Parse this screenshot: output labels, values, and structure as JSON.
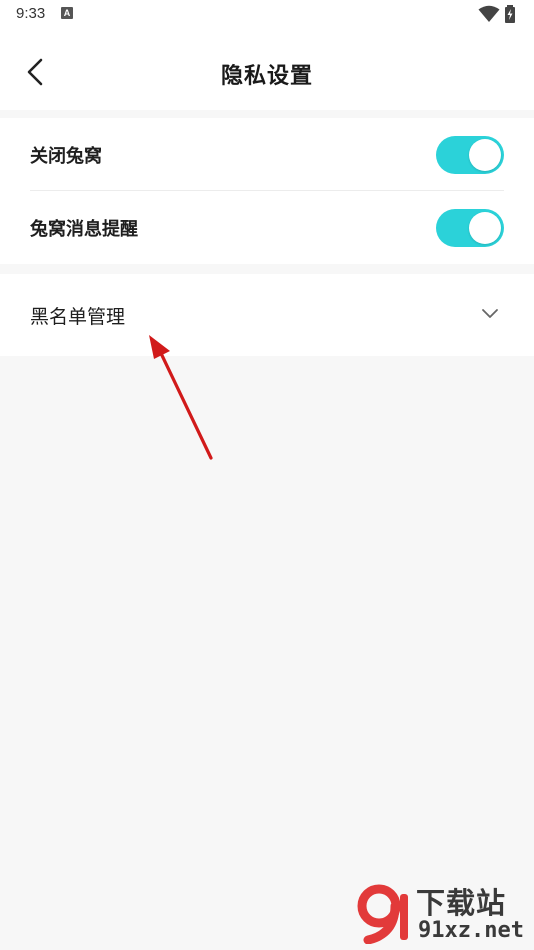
{
  "status_bar": {
    "time": "9:33",
    "app_icon_letter": "A",
    "icons": [
      "wifi-icon",
      "battery-icon"
    ]
  },
  "header": {
    "title": "隐私设置",
    "back_icon": "chevron-left-icon"
  },
  "settings": {
    "items": [
      {
        "label": "关闭兔窝",
        "toggle_on": true
      },
      {
        "label": "兔窝消息提醒",
        "toggle_on": true
      }
    ]
  },
  "blacklist": {
    "label": "黑名单管理",
    "icon": "chevron-down-icon"
  },
  "colors": {
    "accent": "#2bd2d9",
    "background": "#f7f7f7",
    "card": "#ffffff",
    "annotation_arrow": "#d11a1a",
    "watermark_red": "#e23a3a"
  },
  "watermark": {
    "logo_digits": "9",
    "title": "下载站",
    "domain": "91xz.net"
  }
}
